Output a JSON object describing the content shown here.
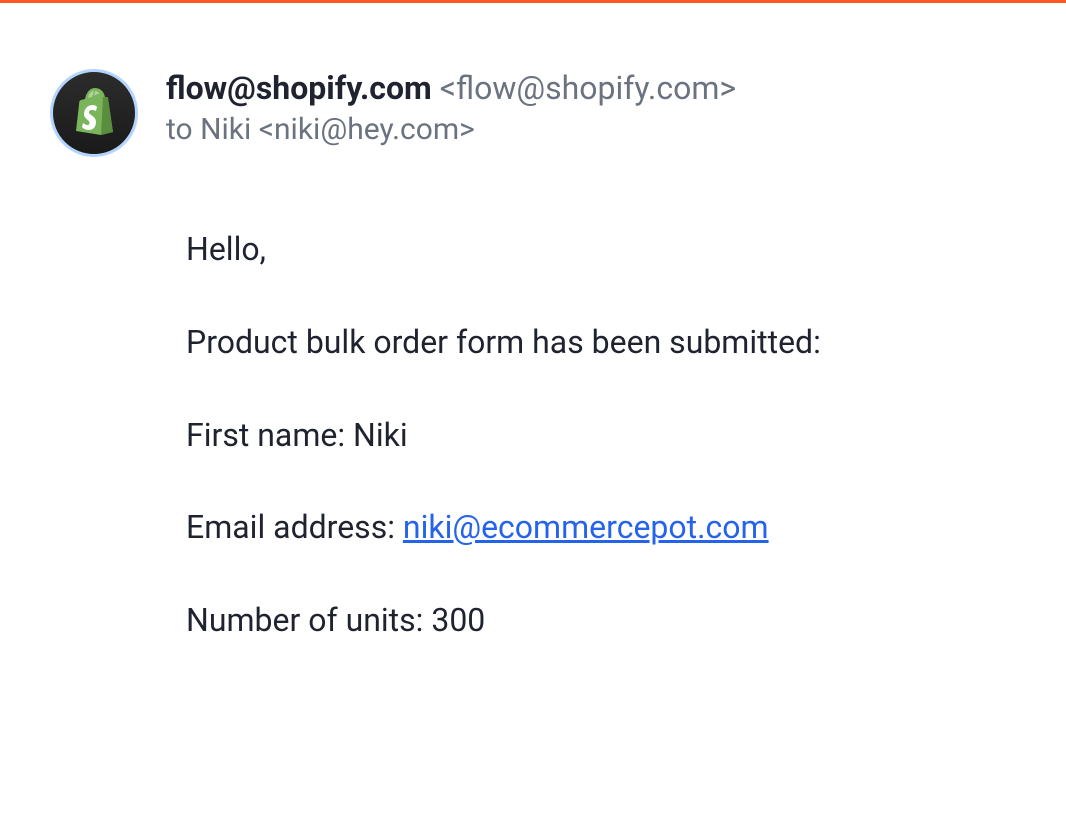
{
  "header": {
    "sender_name": "flow@shopify.com",
    "sender_email": "<flow@shopify.com>",
    "recipient_prefix": "to ",
    "recipient": "Niki <niki@hey.com>"
  },
  "body": {
    "greeting": "Hello,",
    "intro": "Product bulk order form has been submitted:",
    "field1_label": "First name: ",
    "field1_value": "Niki",
    "field2_label": "Email address: ",
    "field2_value": "niki@ecommercepot.com",
    "field3_label": "Number of units: ",
    "field3_value": "300"
  }
}
